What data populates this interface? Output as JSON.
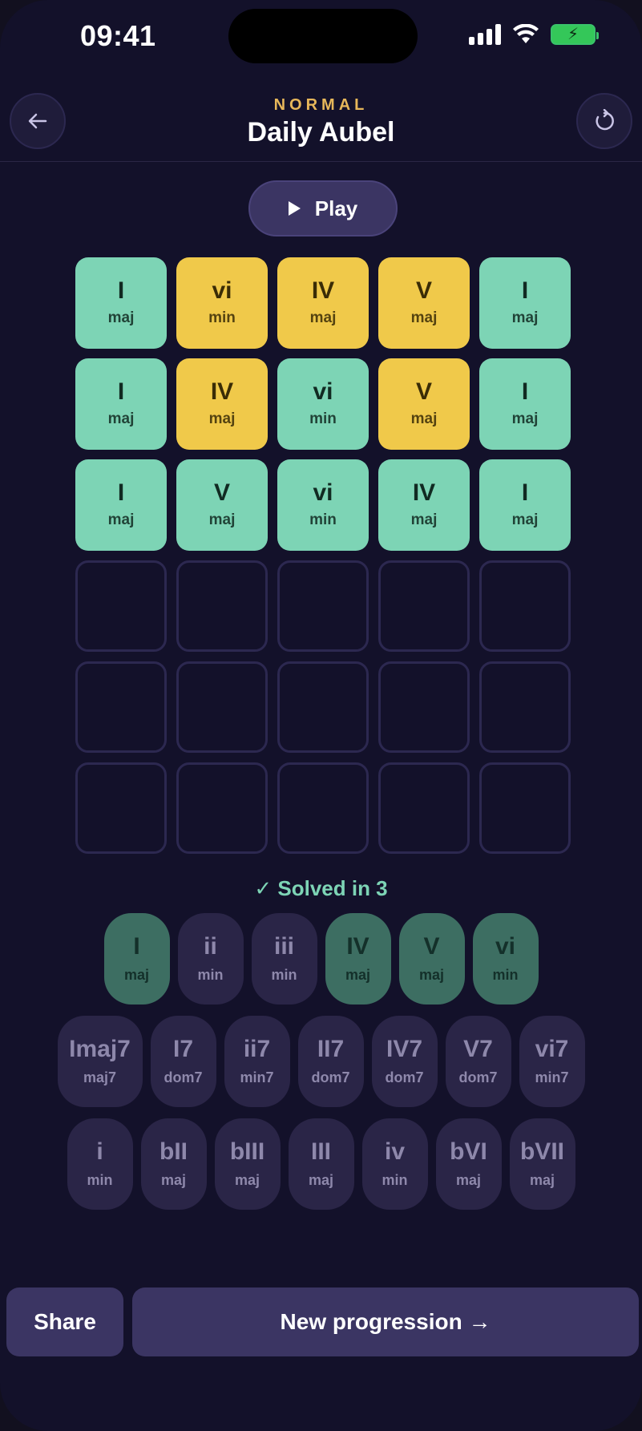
{
  "status": {
    "time": "09:41"
  },
  "header": {
    "mode": "NORMAL",
    "title": "Daily Aubel",
    "back_icon": "arrow-left-icon",
    "reset_icon": "reset-icon"
  },
  "play": {
    "label": "Play"
  },
  "grid": [
    [
      {
        "numeral": "I",
        "quality": "maj",
        "state": "green"
      },
      {
        "numeral": "vi",
        "quality": "min",
        "state": "yellow"
      },
      {
        "numeral": "IV",
        "quality": "maj",
        "state": "yellow"
      },
      {
        "numeral": "V",
        "quality": "maj",
        "state": "yellow"
      },
      {
        "numeral": "I",
        "quality": "maj",
        "state": "green"
      }
    ],
    [
      {
        "numeral": "I",
        "quality": "maj",
        "state": "green"
      },
      {
        "numeral": "IV",
        "quality": "maj",
        "state": "yellow"
      },
      {
        "numeral": "vi",
        "quality": "min",
        "state": "green"
      },
      {
        "numeral": "V",
        "quality": "maj",
        "state": "yellow"
      },
      {
        "numeral": "I",
        "quality": "maj",
        "state": "green"
      }
    ],
    [
      {
        "numeral": "I",
        "quality": "maj",
        "state": "green"
      },
      {
        "numeral": "V",
        "quality": "maj",
        "state": "green"
      },
      {
        "numeral": "vi",
        "quality": "min",
        "state": "green"
      },
      {
        "numeral": "IV",
        "quality": "maj",
        "state": "green"
      },
      {
        "numeral": "I",
        "quality": "maj",
        "state": "green"
      }
    ],
    [
      {
        "state": "empty"
      },
      {
        "state": "empty"
      },
      {
        "state": "empty"
      },
      {
        "state": "empty"
      },
      {
        "state": "empty"
      }
    ],
    [
      {
        "state": "empty"
      },
      {
        "state": "empty"
      },
      {
        "state": "empty"
      },
      {
        "state": "empty"
      },
      {
        "state": "empty"
      }
    ],
    [
      {
        "state": "empty"
      },
      {
        "state": "empty"
      },
      {
        "state": "empty"
      },
      {
        "state": "empty"
      },
      {
        "state": "empty"
      }
    ]
  ],
  "solved": {
    "text": "✓ Solved in 3"
  },
  "palette": {
    "row1": [
      {
        "numeral": "I",
        "quality": "maj",
        "used": true
      },
      {
        "numeral": "ii",
        "quality": "min",
        "used": false
      },
      {
        "numeral": "iii",
        "quality": "min",
        "used": false
      },
      {
        "numeral": "IV",
        "quality": "maj",
        "used": true
      },
      {
        "numeral": "V",
        "quality": "maj",
        "used": true
      },
      {
        "numeral": "vi",
        "quality": "min",
        "used": true
      }
    ],
    "row2": [
      {
        "numeral": "Imaj7",
        "quality": "maj7",
        "used": false
      },
      {
        "numeral": "I7",
        "quality": "dom7",
        "used": false
      },
      {
        "numeral": "ii7",
        "quality": "min7",
        "used": false
      },
      {
        "numeral": "II7",
        "quality": "dom7",
        "used": false
      },
      {
        "numeral": "IV7",
        "quality": "dom7",
        "used": false
      },
      {
        "numeral": "V7",
        "quality": "dom7",
        "used": false
      },
      {
        "numeral": "vi7",
        "quality": "min7",
        "used": false
      }
    ],
    "row3": [
      {
        "numeral": "i",
        "quality": "min",
        "used": false
      },
      {
        "numeral": "bII",
        "quality": "maj",
        "used": false
      },
      {
        "numeral": "bIII",
        "quality": "maj",
        "used": false
      },
      {
        "numeral": "III",
        "quality": "maj",
        "used": false
      },
      {
        "numeral": "iv",
        "quality": "min",
        "used": false
      },
      {
        "numeral": "bVI",
        "quality": "maj",
        "used": false
      },
      {
        "numeral": "bVII",
        "quality": "maj",
        "used": false
      }
    ]
  },
  "footer": {
    "share_label": "Share",
    "new_label": "New progression →"
  },
  "colors": {
    "green": "#7dd4b5",
    "yellow": "#f0c94a",
    "accent": "#e7b75a",
    "button": "#3b3563"
  }
}
